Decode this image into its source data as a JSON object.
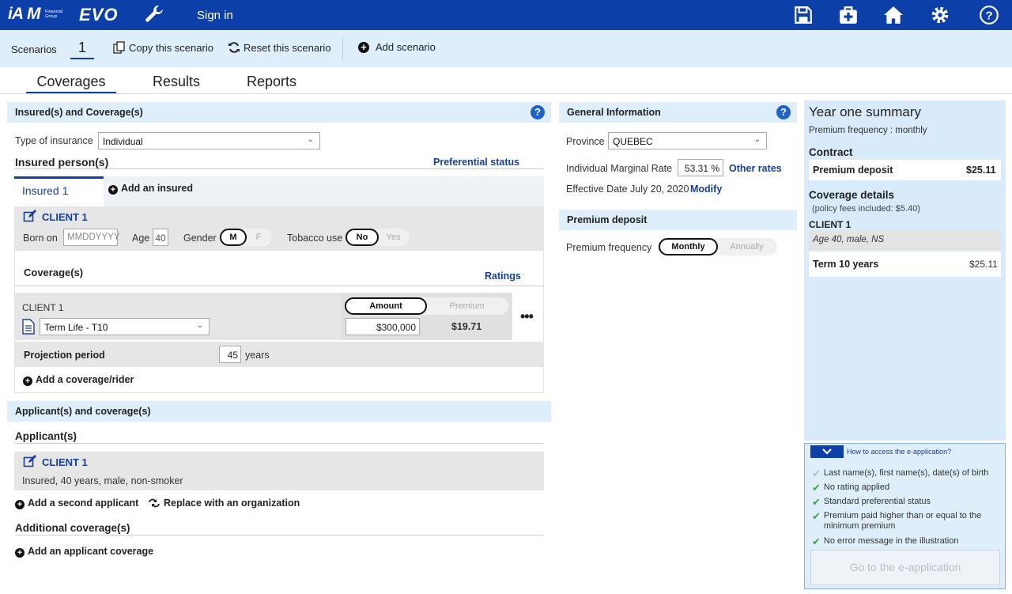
{
  "header": {
    "logo_text": "iA",
    "logo_sub": "Financial Group",
    "app_name": "EVO",
    "signin_label": "Sign in"
  },
  "scenarios": {
    "label": "Scenarios",
    "current": "1",
    "copy_label": "Copy this scenario",
    "reset_label": "Reset this scenario",
    "add_label": "Add scenario"
  },
  "tabs": [
    {
      "label": "Coverages",
      "active": true
    },
    {
      "label": "Results"
    },
    {
      "label": "Reports"
    }
  ],
  "insured_section": {
    "title": "Insured(s) and Coverage(s)",
    "type_label": "Type of insurance",
    "type_value": "Individual",
    "insured_persons_label": "Insured person(s)",
    "preferential_label": "Preferential status",
    "insured_tab": "Insured 1",
    "add_insured": "Add an insured",
    "client_name": "CLIENT 1",
    "born_label": "Born on",
    "born_placeholder": "MMDDYYYY",
    "age_label": "Age",
    "age_value": "40",
    "gender_label": "Gender",
    "gender_m": "M",
    "gender_f": "F",
    "tobacco_label": "Tobacco use",
    "tobacco_no": "No",
    "tobacco_yes": "Yes",
    "coverages_label": "Coverage(s)",
    "ratings_label": "Ratings",
    "cov_client": "CLIENT 1",
    "cov_amount_toggle": "Amount",
    "cov_premium_toggle": "Premium",
    "cov_product": "Term Life - T10",
    "cov_amount": "$300,000",
    "cov_premium": "$19.71",
    "projection_label": "Projection period",
    "projection_value": "45",
    "projection_unit": "years",
    "add_coverage": "Add a coverage/rider"
  },
  "applicant_section": {
    "title": "Applicant(s) and coverage(s)",
    "applicants_label": "Applicant(s)",
    "client_name": "CLIENT 1",
    "client_desc": "Insured, 40 years, male, non-smoker",
    "add_second": "Add a second applicant",
    "replace_org": "Replace with an organization",
    "additional_label": "Additional coverage(s)",
    "add_applicant_cov": "Add an applicant coverage"
  },
  "general_info": {
    "title": "General Information",
    "province_label": "Province",
    "province_value": "QUEBEC",
    "imr_label": "Individual Marginal Rate",
    "imr_value": "53.31 %",
    "other_rates": "Other rates",
    "effective_label": "Effective Date July 20, 2020",
    "modify": "Modify"
  },
  "premium_deposit": {
    "title": "Premium deposit",
    "freq_label": "Premium frequency",
    "monthly": "Monthly",
    "annually": "Annually"
  },
  "summary": {
    "title": "Year one summary",
    "frequency": "Premium frequency : monthly",
    "contract_label": "Contract",
    "premium_deposit_label": "Premium deposit",
    "premium_deposit_value": "$25.11",
    "coverage_details_label": "Coverage details",
    "policy_fees": "(policy fees included: $5.40)",
    "client_name": "CLIENT 1",
    "client_desc": "Age 40, male, NS",
    "term_label": "Term 10 years",
    "term_value": "$25.11"
  },
  "eapp": {
    "link": "How to access the e-application?",
    "items": [
      {
        "text": "Last name(s), first name(s), date(s) of birth",
        "checked": false
      },
      {
        "text": "No rating applied",
        "checked": true
      },
      {
        "text": "Standard preferential status",
        "checked": true
      },
      {
        "text": "Premium paid higher than or equal to the minimum premium",
        "checked": true
      },
      {
        "text": "No error message in the illustration",
        "checked": true
      }
    ],
    "button": "Go to the e-application"
  },
  "colors": {
    "brand": "#0c3fa8",
    "panel": "#deeefa",
    "check": "#3aaa35"
  }
}
